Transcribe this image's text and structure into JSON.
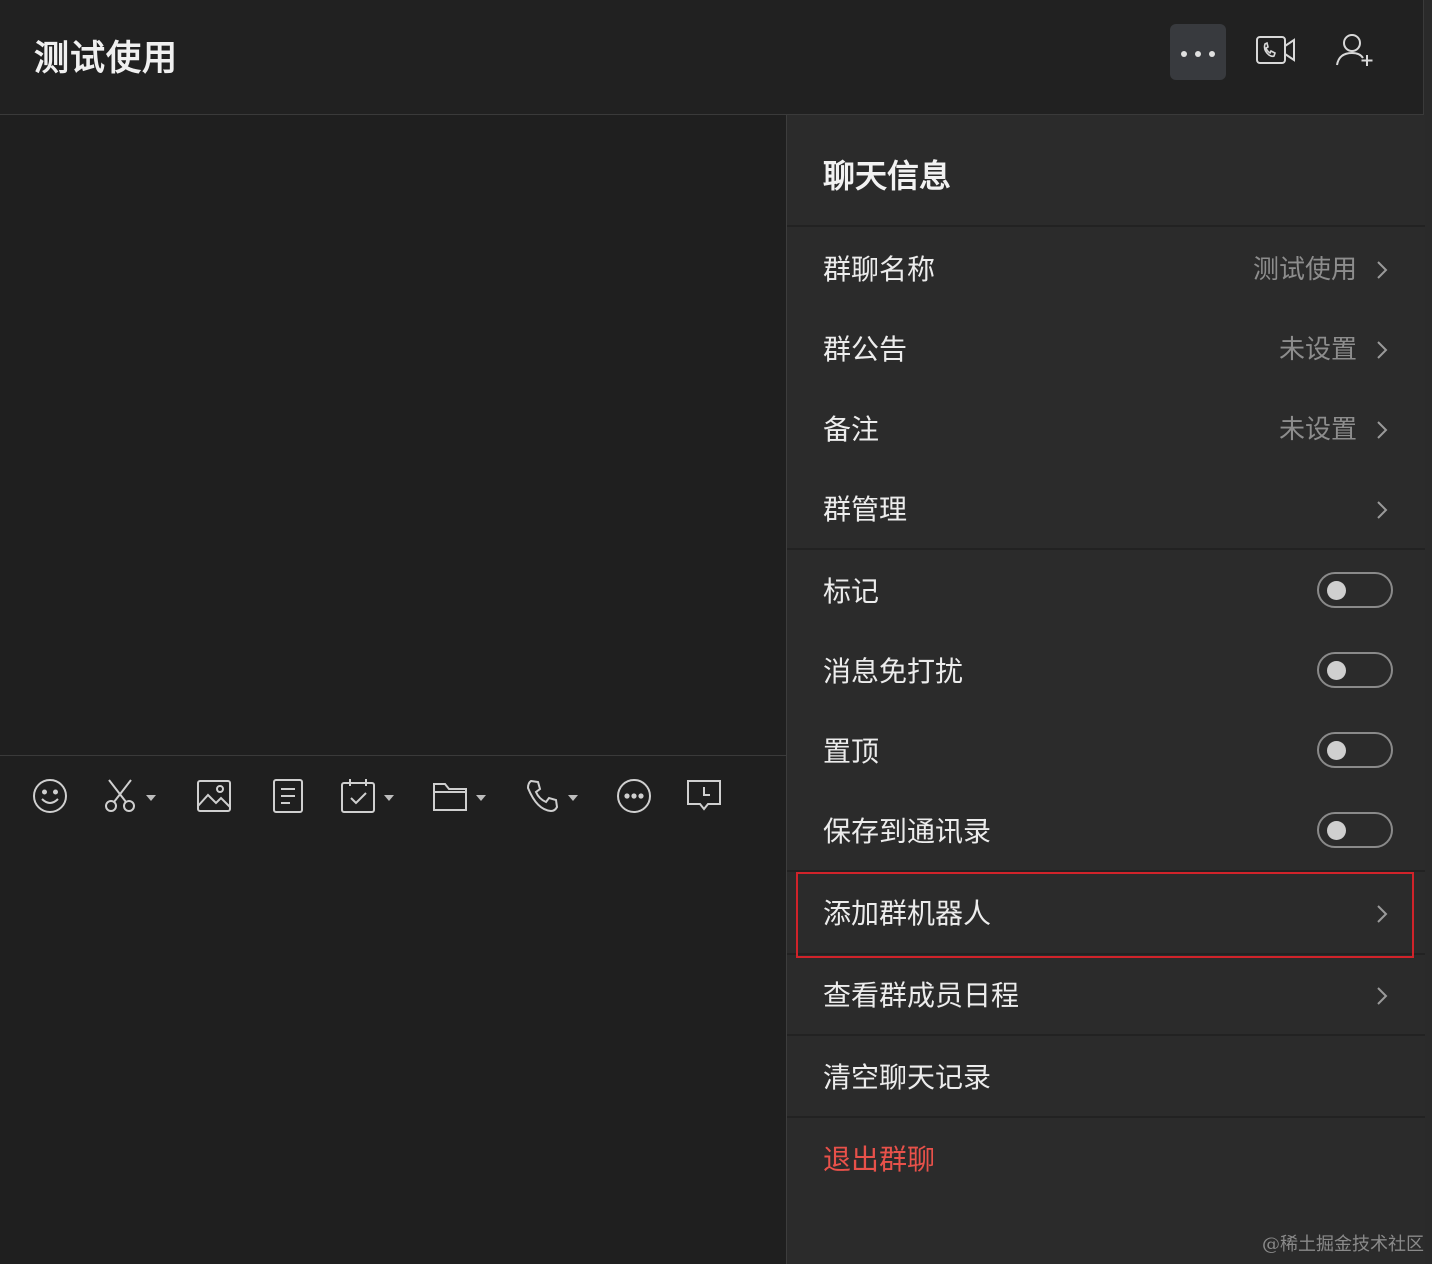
{
  "header": {
    "title": "测试使用",
    "buttons": [
      "more-icon",
      "video-call-icon",
      "add-member-icon"
    ]
  },
  "toolbar": {
    "icons": [
      "emoji-icon",
      "screenshot-icon",
      "image-icon",
      "document-icon",
      "task-icon",
      "folder-icon",
      "phone-icon",
      "more-circle-icon",
      "feedback-icon"
    ]
  },
  "panel": {
    "title": "聊天信息",
    "group_name": {
      "label": "群聊名称",
      "value": "测试使用"
    },
    "announcement": {
      "label": "群公告",
      "value": "未设置"
    },
    "remark": {
      "label": "备注",
      "value": "未设置"
    },
    "manage": {
      "label": "群管理"
    },
    "mark": {
      "label": "标记",
      "on": false
    },
    "mute": {
      "label": "消息免打扰",
      "on": false
    },
    "pin": {
      "label": "置顶",
      "on": false
    },
    "save_contacts": {
      "label": "保存到通讯录",
      "on": false
    },
    "add_bot": {
      "label": "添加群机器人"
    },
    "schedule": {
      "label": "查看群成员日程"
    },
    "clear_history": {
      "label": "清空聊天记录"
    },
    "exit_group": {
      "label": "退出群聊"
    }
  },
  "colors": {
    "danger": "#e8514a",
    "highlight": "#d0232a",
    "background": "#1f1f1f",
    "panel": "#2b2b2b"
  },
  "watermark": "@稀土掘金技术社区"
}
